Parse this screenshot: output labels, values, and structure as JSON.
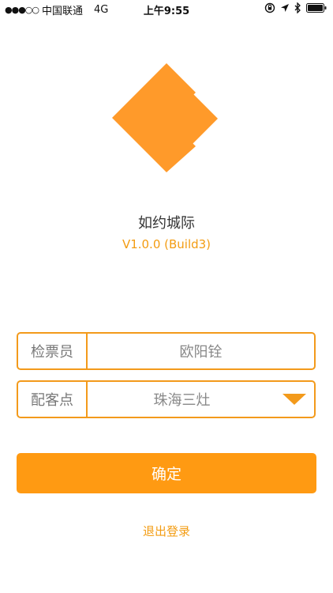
{
  "status_bar": {
    "signal": "●●●○○",
    "carrier": "中国联通",
    "network": "4G",
    "time": "上午9:55",
    "icons": [
      "orientation-lock-icon",
      "location-arrow-icon",
      "bluetooth-icon",
      "battery-icon"
    ]
  },
  "app": {
    "name": "如约城际",
    "version": "V1.0.0 (Build3)",
    "logo_icon": "app-logo-icon",
    "accent_color": "#ff9a12"
  },
  "form": {
    "inspector": {
      "label": "检票员",
      "value": "欧阳铨"
    },
    "station": {
      "label": "配客点",
      "value": "珠海三灶",
      "dropdown_icon": "triangle-down-icon"
    }
  },
  "actions": {
    "confirm_label": "确定",
    "logout_label": "退出登录"
  }
}
